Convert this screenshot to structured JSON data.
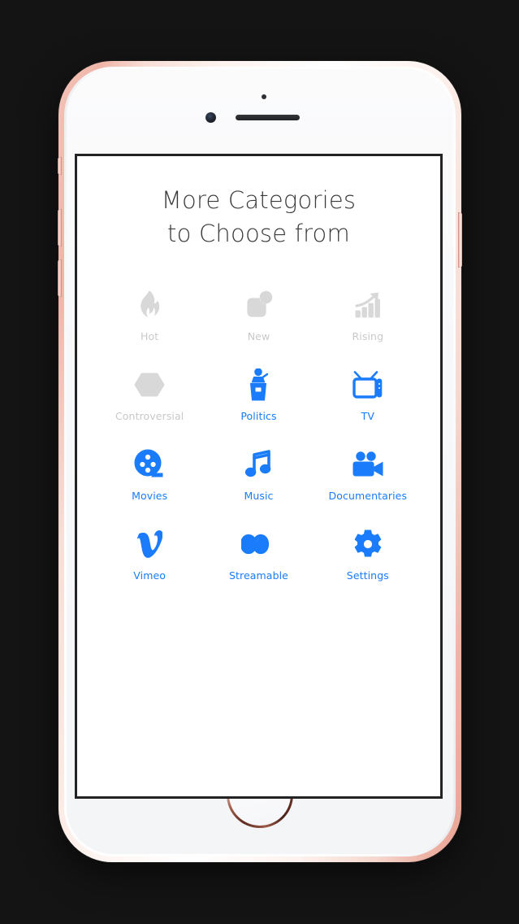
{
  "device": {
    "name": "iphone-rose-gold",
    "body_color": "#ffffff",
    "edge_color": "#f0b5a8"
  },
  "screen": {
    "background": "#ffffff",
    "border_color": "#232323"
  },
  "app": {
    "title": "More Categories\nto Choose  from",
    "accent_color": "#1a7cfa",
    "disabled_color": "#d8d8d8",
    "categories": [
      {
        "label": "Hot",
        "icon": "flame-icon",
        "state": "disabled"
      },
      {
        "label": "New",
        "icon": "new-badge-icon",
        "state": "disabled"
      },
      {
        "label": "Rising",
        "icon": "trending-up-icon",
        "state": "disabled"
      },
      {
        "label": "Controversial",
        "icon": "hexagon-s-icon",
        "state": "disabled"
      },
      {
        "label": "Politics",
        "icon": "podium-speaker-icon",
        "state": "active"
      },
      {
        "label": "TV",
        "icon": "television-icon",
        "state": "active"
      },
      {
        "label": "Movies",
        "icon": "film-reel-icon",
        "state": "active"
      },
      {
        "label": "Music",
        "icon": "music-note-icon",
        "state": "active"
      },
      {
        "label": "Documentaries",
        "icon": "movie-camera-icon",
        "state": "active"
      },
      {
        "label": "Vimeo",
        "icon": "vimeo-icon",
        "state": "active"
      },
      {
        "label": "Streamable",
        "icon": "streamable-icon",
        "state": "active"
      },
      {
        "label": "Settings",
        "icon": "gear-icon",
        "state": "active"
      }
    ]
  }
}
